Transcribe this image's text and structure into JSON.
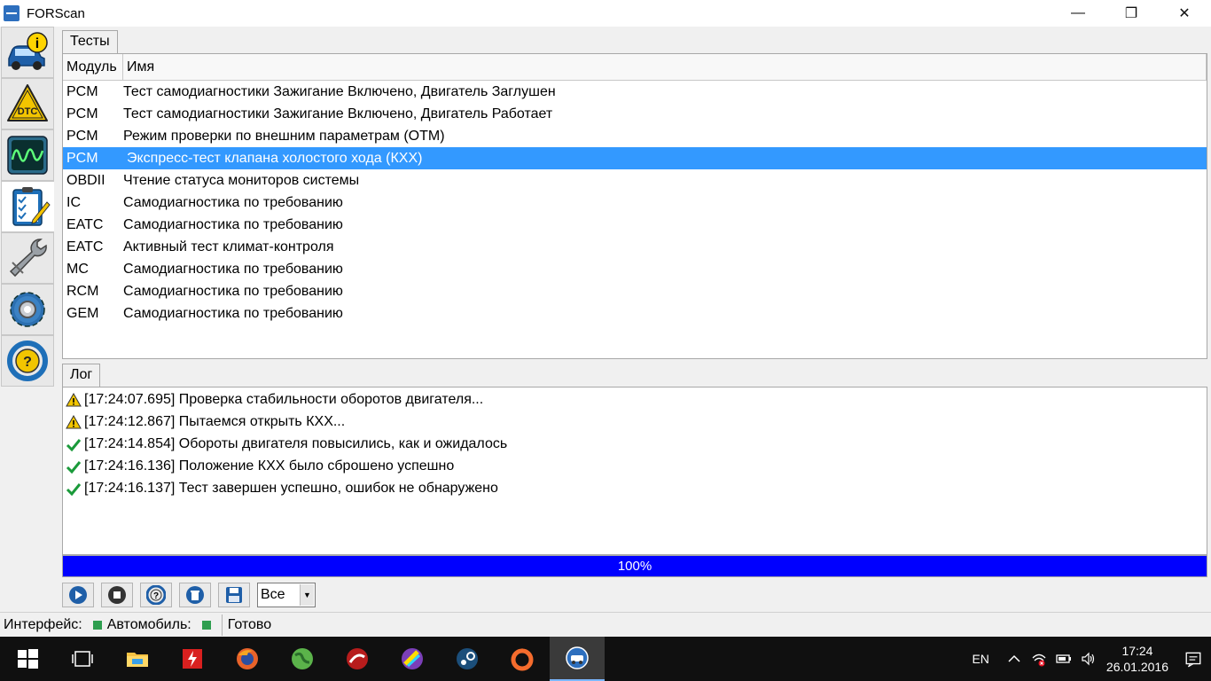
{
  "window": {
    "title": "FORScan",
    "minimize": "—",
    "maximize": "❐",
    "close": "✕"
  },
  "sidebar": {
    "items": [
      {
        "name": "vehicle-info",
        "icon": "car-info-icon"
      },
      {
        "name": "dtc",
        "icon": "dtc-warning-icon",
        "label": "DTC"
      },
      {
        "name": "oscilloscope",
        "icon": "oscilloscope-icon"
      },
      {
        "name": "tests",
        "icon": "checklist-icon",
        "active": true
      },
      {
        "name": "service",
        "icon": "wrench-icon"
      },
      {
        "name": "settings",
        "icon": "gear-icon"
      },
      {
        "name": "help",
        "icon": "steering-help-icon"
      }
    ]
  },
  "tests": {
    "tab_label": "Тесты",
    "columns": [
      "Модуль",
      "Имя"
    ],
    "rows": [
      {
        "module": "PCM",
        "name": "Тест самодиагностики Зажигание Включено, Двигатель Заглушен"
      },
      {
        "module": "PCM",
        "name": "Тест самодиагностики Зажигание Включено, Двигатель Работает"
      },
      {
        "module": "PCM",
        "name": "Режим проверки по внешним параметрам (OTM)"
      },
      {
        "module": "PCM",
        "name": "Экспресс-тест клапана холостого хода (КХХ)",
        "selected": true
      },
      {
        "module": "OBDII",
        "name": "Чтение статуса мониторов системы"
      },
      {
        "module": "IC",
        "name": "Самодиагностика по требованию"
      },
      {
        "module": "EATC",
        "name": "Самодиагностика по требованию"
      },
      {
        "module": "EATC",
        "name": "Активный тест климат-контроля"
      },
      {
        "module": "MC",
        "name": "Самодиагностика по требованию"
      },
      {
        "module": "RCM",
        "name": "Самодиагностика по требованию"
      },
      {
        "module": "GEM",
        "name": "Самодиагностика по требованию"
      }
    ]
  },
  "log": {
    "tab_label": "Лог",
    "entries": [
      {
        "icon": "warning-icon",
        "text": "[17:24:07.695] Проверка стабильности оборотов двигателя..."
      },
      {
        "icon": "warning-icon",
        "text": "[17:24:12.867] Пытаемся открыть КХХ..."
      },
      {
        "icon": "check-icon",
        "text": "[17:24:14.854] Обороты двигателя повысились, как и ожидалось"
      },
      {
        "icon": "check-icon",
        "text": "[17:24:16.136] Положение КХХ было сброшено успешно"
      },
      {
        "icon": "check-icon",
        "text": "[17:24:16.137] Тест завершен успешно, ошибок не обнаружено"
      }
    ]
  },
  "progress": {
    "value": 100,
    "label": "100%",
    "color": "#0000ff"
  },
  "toolbar": {
    "buttons": [
      "play-icon",
      "stop-icon",
      "help-icon",
      "delete-icon",
      "save-icon"
    ],
    "filter_value": "Все"
  },
  "status": {
    "interface_label": "Интерфейс:",
    "vehicle_label": "Автомобиль:",
    "state": "Готово",
    "indicator_color": "#2e9e4f"
  },
  "taskbar": {
    "apps": [
      "windows-start-icon",
      "task-view-icon",
      "file-explorer-icon",
      "red-lightning-app-icon",
      "firefox-icon",
      "globe-app-icon",
      "red-circle-app-icon",
      "colorful-app-icon",
      "steam-icon",
      "origin-icon",
      "forscan-app-icon"
    ],
    "language": "EN",
    "time": "17:24",
    "date": "26.01.2016"
  },
  "colors": {
    "selection": "#3399ff",
    "accent": "#0000ff"
  }
}
